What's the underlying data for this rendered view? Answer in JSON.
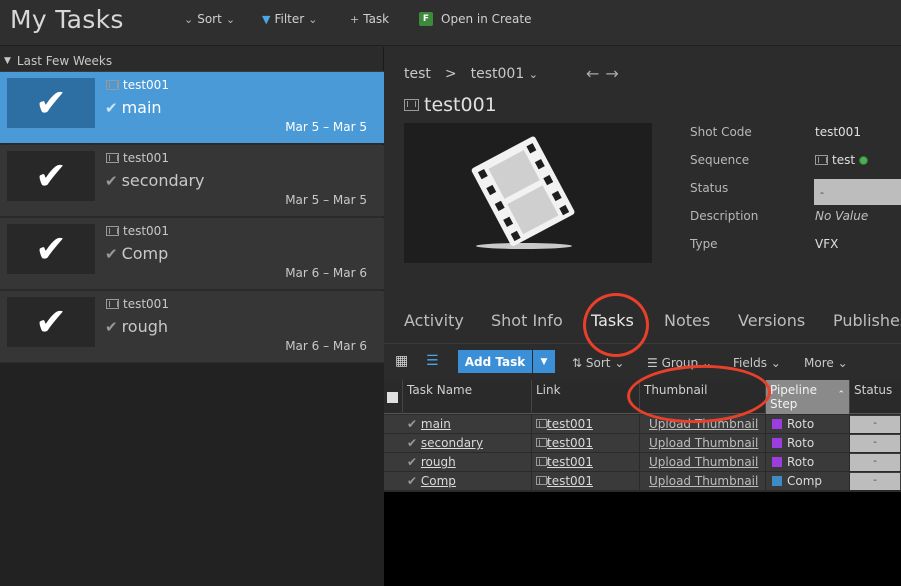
{
  "header": {
    "title": "My Tasks",
    "sort_label": "Sort",
    "filter_label": "Filter",
    "task_label": "Task",
    "create_label": "Open in Create",
    "create_logo": "F"
  },
  "sidebar": {
    "group_label": "Last Few Weeks",
    "tasks": [
      {
        "entity": "test001",
        "name": "main",
        "dates": "Mar 5 – Mar 5"
      },
      {
        "entity": "test001",
        "name": "secondary",
        "dates": "Mar 5 – Mar 5"
      },
      {
        "entity": "test001",
        "name": "Comp",
        "dates": "Mar 6 – Mar 6"
      },
      {
        "entity": "test001",
        "name": "rough",
        "dates": "Mar 6 – Mar 6"
      }
    ]
  },
  "detail": {
    "breadcrumb": {
      "root": "test",
      "sep": ">",
      "current": "test001"
    },
    "title": "test001",
    "fields": [
      {
        "label": "Shot Code",
        "value": "test001"
      },
      {
        "label": "Sequence",
        "value": "test"
      },
      {
        "label": "Status",
        "value": "-"
      },
      {
        "label": "Description",
        "value": "No Value"
      },
      {
        "label": "Type",
        "value": "VFX"
      }
    ],
    "tabs": [
      "Activity",
      "Shot Info",
      "Tasks",
      "Notes",
      "Versions",
      "Publishes"
    ],
    "active_tab": "Tasks"
  },
  "toolbar": {
    "add_task": "Add Task",
    "sort": "Sort",
    "group": "Group",
    "fields": "Fields",
    "more": "More"
  },
  "grid": {
    "headers": {
      "task_name": "Task Name",
      "link": "Link",
      "thumbnail": "Thumbnail",
      "pipeline_step": "Pipeline Step",
      "status": "Status"
    },
    "rows": [
      {
        "name": "main",
        "link": "test001",
        "thumb": "Upload Thumbnail",
        "step": "Roto",
        "step_color": "#9c3de0",
        "status": "-"
      },
      {
        "name": "secondary",
        "link": "test001",
        "thumb": "Upload Thumbnail",
        "step": "Roto",
        "step_color": "#9c3de0",
        "status": "-"
      },
      {
        "name": "rough",
        "link": "test001",
        "thumb": "Upload Thumbnail",
        "step": "Roto",
        "step_color": "#9c3de0",
        "status": "-"
      },
      {
        "name": "Comp",
        "link": "test001",
        "thumb": "Upload Thumbnail",
        "step": "Comp",
        "step_color": "#3d8ac4",
        "status": "-"
      }
    ]
  },
  "colors": {
    "accent": "#4a9ad8",
    "annotation": "#e8402a"
  }
}
